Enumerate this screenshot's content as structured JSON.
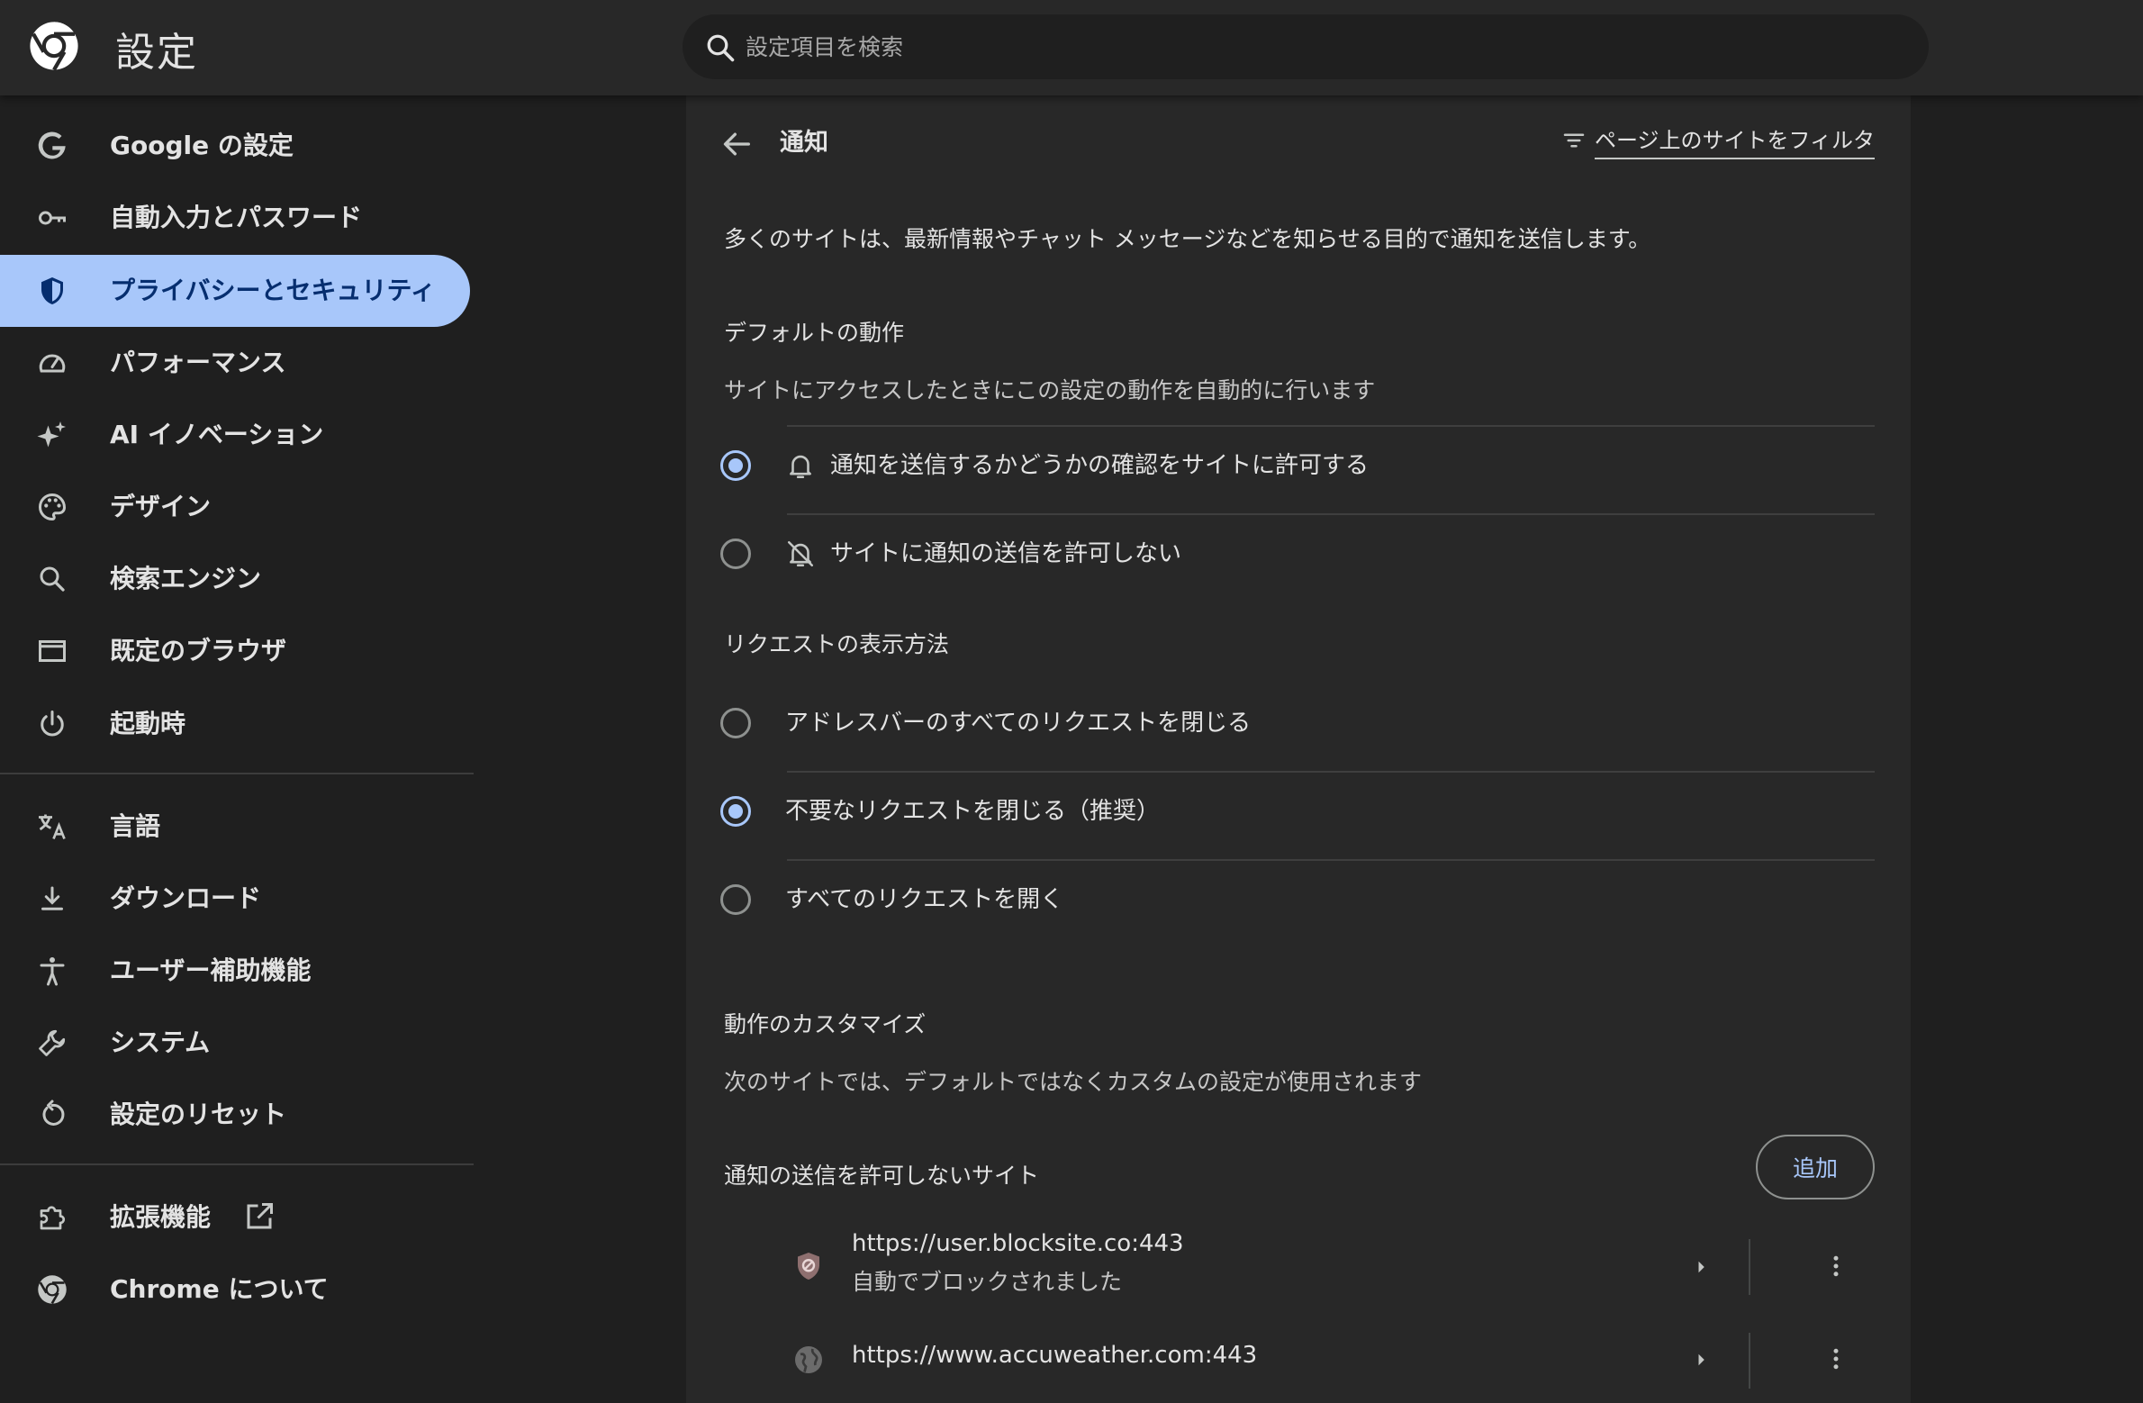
{
  "header": {
    "title": "設定",
    "logo_icon": "chrome-logo-icon",
    "search_placeholder": "設定項目を検索"
  },
  "sidebar": {
    "items": [
      {
        "label": "Google の設定",
        "icon": "google-g-icon"
      },
      {
        "label": "自動入力とパスワード",
        "icon": "key-icon"
      },
      {
        "label": "プライバシーとセキュリティ",
        "icon": "shield-icon",
        "active": true
      },
      {
        "label": "パフォーマンス",
        "icon": "speedometer-icon"
      },
      {
        "label": "AI イノベーション",
        "icon": "sparkle-icon"
      },
      {
        "label": "デザイン",
        "icon": "palette-icon"
      },
      {
        "label": "検索エンジン",
        "icon": "search-icon"
      },
      {
        "label": "既定のブラウザ",
        "icon": "browser-window-icon"
      },
      {
        "label": "起動時",
        "icon": "power-icon"
      },
      {
        "label": "言語",
        "icon": "translate-icon"
      },
      {
        "label": "ダウンロード",
        "icon": "download-icon"
      },
      {
        "label": "ユーザー補助機能",
        "icon": "accessibility-icon"
      },
      {
        "label": "システム",
        "icon": "wrench-icon"
      },
      {
        "label": "設定のリセット",
        "icon": "reset-icon"
      },
      {
        "label": "拡張機能",
        "icon": "puzzle-icon"
      },
      {
        "label": "Chrome について",
        "icon": "chrome-icon"
      }
    ]
  },
  "main": {
    "title": "通知",
    "filter_label": "ページ上のサイトをフィルタ",
    "intro": "多くのサイトは、最新情報やチャット メッセージなどを知らせる目的で通知を送信します。",
    "default_section": {
      "heading": "デフォルトの動作",
      "sub": "サイトにアクセスしたときにこの設定の動作を自動的に行います",
      "options": [
        {
          "label": "通知を送信するかどうかの確認をサイトに許可する",
          "icon": "bell-icon",
          "checked": true
        },
        {
          "label": "サイトに通知の送信を許可しない",
          "icon": "bell-off-icon",
          "checked": false
        }
      ]
    },
    "request_section": {
      "heading": "リクエストの表示方法",
      "options": [
        {
          "label": "アドレスバーのすべてのリクエストを閉じる",
          "checked": false
        },
        {
          "label": "不要なリクエストを閉じる（推奨）",
          "checked": true
        },
        {
          "label": "すべてのリクエストを開く",
          "checked": false
        }
      ]
    },
    "custom_section": {
      "heading": "動作のカスタマイズ",
      "sub": "次のサイトでは、デフォルトではなくカスタムの設定が使用されます"
    },
    "blocked": {
      "heading": "通知の送信を許可しないサイト",
      "add_label": "追加",
      "sites": [
        {
          "url": "https://user.blocksite.co:443",
          "note": "自動でブロックされました",
          "icon": "shield-site-icon"
        },
        {
          "url": "https://www.accuweather.com:443",
          "icon": "globe-icon"
        }
      ]
    }
  },
  "colors": {
    "background": "#1f1f1f",
    "surface": "#282828",
    "accent": "#a8c7fa",
    "active_text": "#062e6f"
  }
}
